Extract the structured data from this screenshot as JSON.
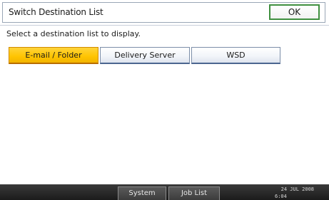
{
  "header": {
    "title": "Switch Destination List",
    "ok_label": "OK"
  },
  "instruction": "Select a destination list to display.",
  "destination_lists": [
    {
      "label": "E-mail / Folder",
      "selected": true
    },
    {
      "label": "Delivery Server",
      "selected": false
    },
    {
      "label": "WSD",
      "selected": false
    }
  ],
  "status_bar": {
    "system_status_label": "System Status",
    "job_list_label": "Job List",
    "date": "24  JUL  2008",
    "time": "6:04"
  },
  "colors": {
    "selected_tab": "#ffc400",
    "ok_border": "#3f8f3f",
    "status_bar": "#1b1b1b"
  }
}
